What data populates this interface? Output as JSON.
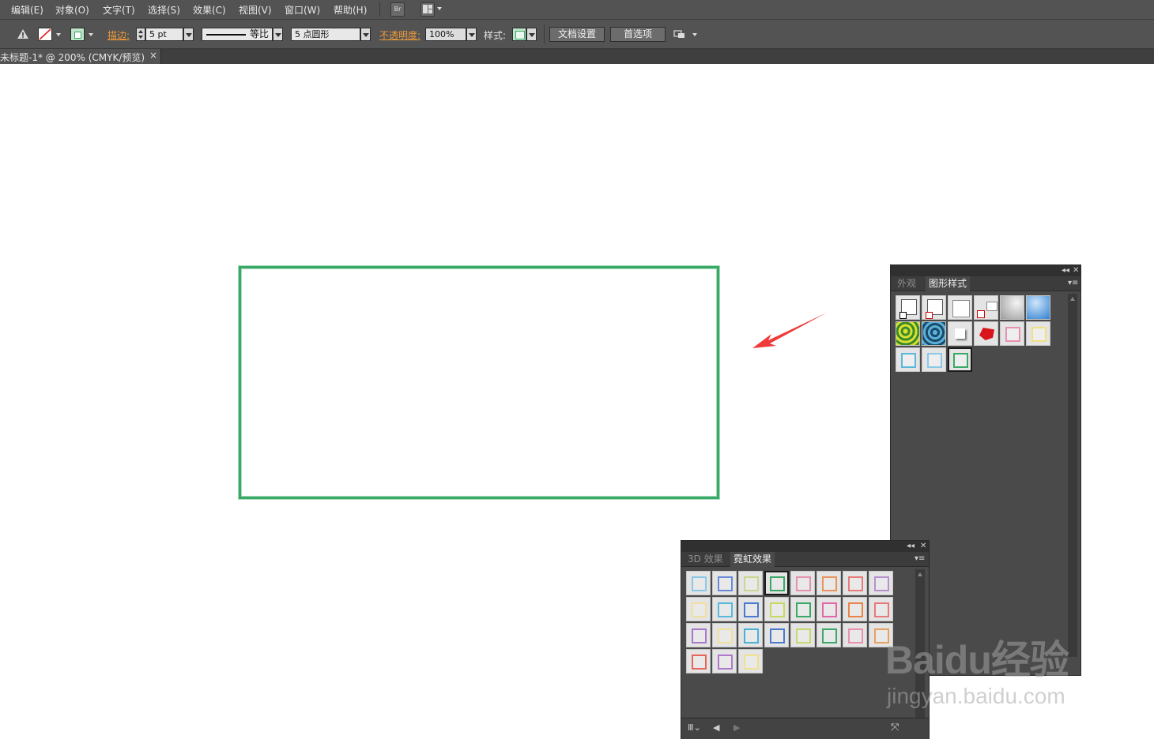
{
  "menu": {
    "items": [
      "编辑(E)",
      "对象(O)",
      "文字(T)",
      "选择(S)",
      "效果(C)",
      "视图(V)",
      "窗口(W)",
      "帮助(H)"
    ],
    "bridge_label": "Br"
  },
  "control_bar": {
    "stroke_label": "描边:",
    "stroke_value": "5 pt",
    "profile_label": "等比",
    "brush_value": "5 点圆形",
    "opacity_label": "不透明度:",
    "opacity_value": "100%",
    "style_label": "样式:",
    "doc_setup_button": "文档设置",
    "preferences_button": "首选项"
  },
  "document_tab": {
    "title": "未标题-1* @ 200% (CMYK/预览)",
    "close": "×"
  },
  "graphic_styles_panel": {
    "tabs": [
      {
        "label": "外观",
        "active": false
      },
      {
        "label": "图形样式",
        "active": true
      }
    ],
    "swatches": [
      {
        "kind": "default-fill",
        "color": "#ffffff"
      },
      {
        "kind": "default-stroke",
        "color": "#ffffff"
      },
      {
        "kind": "white",
        "color": "#ffffff"
      },
      {
        "kind": "none-pair",
        "color": "#ffffff"
      },
      {
        "kind": "gradient-gray",
        "color": "#b8b8b8"
      },
      {
        "kind": "gradient-blue",
        "color": "#3a8ad8"
      },
      {
        "kind": "green-swirl",
        "color": "#6ab02a"
      },
      {
        "kind": "blue-swirl",
        "color": "#2a6a8a"
      },
      {
        "kind": "shadow",
        "color": "#ffffff"
      },
      {
        "kind": "red-3d",
        "color": "#d8141c"
      },
      {
        "kind": "pink-frame",
        "color": "#e890b0"
      },
      {
        "kind": "yellow-frame",
        "color": "#f0e080"
      },
      {
        "kind": "cyan-frame",
        "color": "#5ab8dc"
      },
      {
        "kind": "lightblue-frame",
        "color": "#8ac8e8"
      },
      {
        "kind": "green-frame-selected",
        "color": "#3aa867"
      }
    ]
  },
  "neon_panel": {
    "tabs": [
      {
        "label": "3D 效果",
        "active": false
      },
      {
        "label": "霓虹效果",
        "active": true
      }
    ],
    "swatches": [
      "#8ac8e8",
      "#6a8ad8",
      "#c8d890",
      "#3aa867",
      "#e890b0",
      "#e8945a",
      "#e87a7a",
      "#b890d0",
      "#f0e0a0",
      "#5ab8dc",
      "#4a7ad0",
      "#c8d860",
      "#3aa867",
      "#e068a8",
      "#e8844a",
      "#e87a7a",
      "#a878c8",
      "#f0e0a0",
      "#4ab0d8",
      "#4a7ad0",
      "#c8d870",
      "#3aa867",
      "#e890b0",
      "#e8a060",
      "#e8645a",
      "#b078c8",
      "#f0e090"
    ],
    "selected_index": 3
  },
  "watermark": {
    "logo": "Baidu经验",
    "url": "jingyan.baidu.com"
  }
}
